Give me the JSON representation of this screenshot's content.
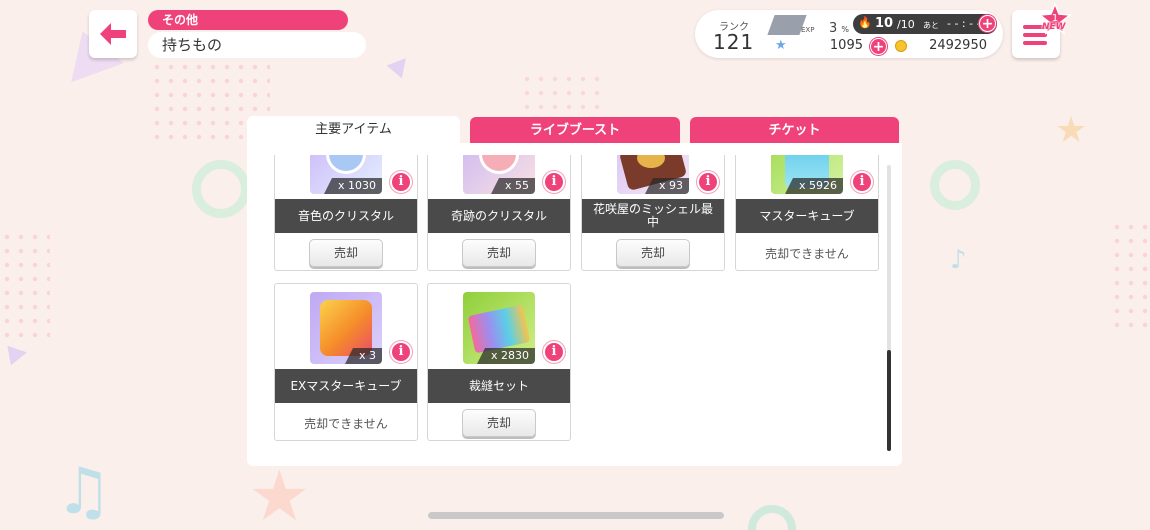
{
  "header": {
    "back_icon": "arrow-left-icon",
    "category": "その他",
    "title": "持ちもの"
  },
  "status": {
    "rank_label": "ランク",
    "rank": "121",
    "exp_label": "EXP",
    "exp_percent": "3",
    "exp_percent_sym": "%",
    "stamina_current": "10",
    "stamina_max": "/10",
    "stamina_ato": "あと",
    "stamina_timer": "- - : - -",
    "star_gems": "1095",
    "coins": "2492950",
    "plus": "+"
  },
  "menu": {
    "badge": "NEW",
    "badge_count": "1"
  },
  "tabs": [
    {
      "label": "主要アイテム",
      "active": true
    },
    {
      "label": "ライブブースト",
      "active": false
    },
    {
      "label": "チケット",
      "active": false
    }
  ],
  "items": [
    {
      "name": "音色のクリスタル",
      "qty": "x 1030",
      "sell": "売却",
      "sellable": true,
      "icon": "blue-crystal-icon",
      "color": "#c8b8f4"
    },
    {
      "name": "奇跡のクリスタル",
      "qty": "x 55",
      "sell": "売却",
      "sellable": true,
      "icon": "pink-crystal-icon",
      "color": "#f6c2c8"
    },
    {
      "name": "花咲屋のミッシェル最中",
      "qty": "x 93",
      "sell": "売却",
      "sellable": true,
      "icon": "monaka-icon",
      "color": "#7a3b2a"
    },
    {
      "name": "マスターキューブ",
      "qty": "x 5926",
      "sell": "売却できません",
      "sellable": false,
      "icon": "master-cube-icon",
      "color": "#5cc8e0"
    },
    {
      "name": "EXマスターキューブ",
      "qty": "x 3",
      "sell": "売却できません",
      "sellable": false,
      "icon": "ex-master-cube-icon",
      "color": "#f7a13a"
    },
    {
      "name": "裁縫セット",
      "qty": "x 2830",
      "sell": "売却",
      "sellable": true,
      "icon": "sewing-set-icon",
      "color": "#8fcf3a"
    }
  ],
  "info_label": "i"
}
